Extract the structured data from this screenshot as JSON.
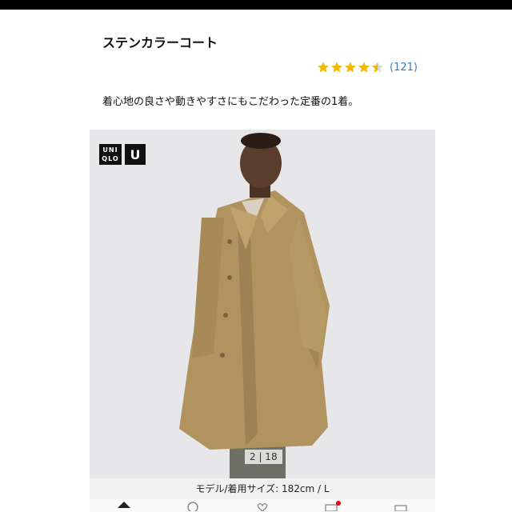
{
  "product": {
    "title": "ステンカラーコート",
    "rating_value": 4.5,
    "rating_count": "(121)",
    "description": "着心地の良さや動きやすさにもこだわった定番の1着。"
  },
  "image": {
    "logo_uniqlo_line1": "UNI",
    "logo_uniqlo_line2": "QLO",
    "logo_u": "U",
    "counter": "2 | 18",
    "caption": "モデル/着用サイズ: 182cm / L"
  },
  "colors": {
    "star": "#f5b700",
    "rating_count": "#3a7bbf",
    "badge": "#e60012",
    "coat": "#b0935f"
  },
  "nav": {
    "icons": [
      "home-icon",
      "search-icon",
      "heart-icon",
      "cart-icon",
      "menu-icon"
    ]
  }
}
